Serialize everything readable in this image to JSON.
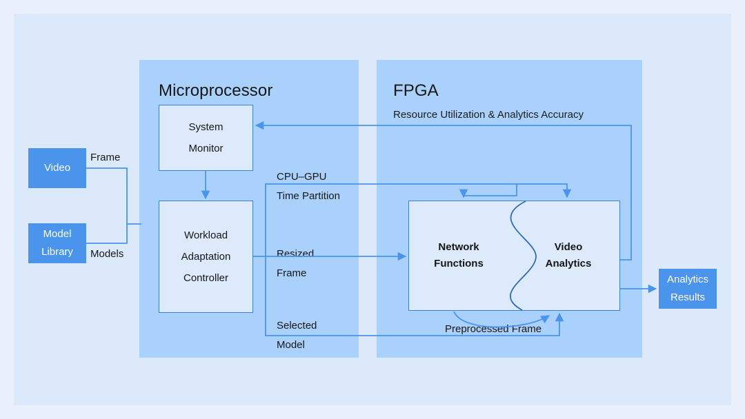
{
  "diagram": {
    "title": "FPGA-accelerated video analytics system architecture",
    "panels": [
      {
        "id": "microprocessor",
        "title": "Microprocessor",
        "subtitle": ""
      },
      {
        "id": "fpga",
        "title": "FPGA",
        "subtitle": "Resource Utilization & Analytics Accuracy"
      }
    ],
    "boxes": {
      "system_monitor": {
        "line1": "System",
        "line2": "Monitor"
      },
      "workload_controller": {
        "line1": "Workload",
        "line2": "Adaptation",
        "line3": "Controller"
      },
      "network_functions": {
        "line1": "Network",
        "line2": "Functions"
      },
      "video_analytics": {
        "line1": "Video",
        "line2": "Analytics"
      }
    },
    "io": {
      "video": {
        "line1": "Video",
        "line2": ""
      },
      "model_library": {
        "line1": "Model",
        "line2": "Library"
      },
      "analytics_results": {
        "line1": "Analytics",
        "line2": "Results"
      }
    },
    "edge_labels": {
      "frame": "Frame",
      "models": "Models",
      "cpu_gpu_partition_line1": "CPU–GPU",
      "cpu_gpu_partition_line2": "Time Partition",
      "resized_frame_line1": "Resized",
      "resized_frame_line2": "Frame",
      "selected_model_line1": "Selected",
      "selected_model_line2": "Model",
      "preprocessed_frame": "Preprocessed Frame"
    },
    "colors": {
      "page_background": "#eaf1fd",
      "canvas_background": "#dbe9fb",
      "panel_background": "#aad1fb",
      "box_background": "#dceafc",
      "box_border": "#3d7fd1",
      "accent_blue": "#4a94ec",
      "wire": "#4a94ec",
      "text": "#161616",
      "io_text": "#ffffff"
    }
  }
}
